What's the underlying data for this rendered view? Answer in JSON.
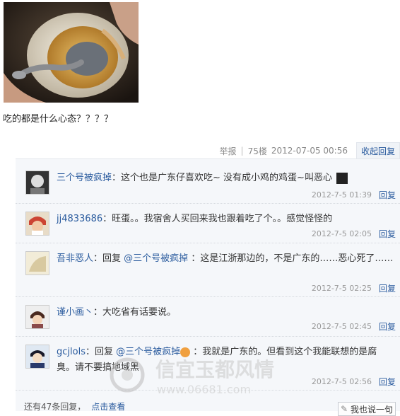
{
  "post": {
    "text": "吃的都是什么心态？？？？"
  },
  "meta": {
    "report": "举报",
    "floor": "75楼",
    "datetime": "2012-07-05 00:56",
    "collapse": "收起回复"
  },
  "replies": [
    {
      "user": "三个号被疯掉",
      "sep": "：",
      "content": "这个也是广东仔喜欢吃~ 没有成小鸡的鸡蛋~叫恶心",
      "time": "2012-7-5 01:39",
      "reply_label": "回复"
    },
    {
      "user": "jj4833686",
      "sep": "：",
      "content": "旺蛋。。我宿舍人买回来我也跟着吃了个。。感觉怪怪的",
      "time": "2012-7-5 02:05",
      "reply_label": "回复"
    },
    {
      "user": "吾非恶人",
      "sep": "：",
      "prefix": "回复 ",
      "mention": "@三个号被疯掉",
      "content": " ：这是江浙那边的，不是广东的……恶心死了……",
      "time": "2012-7-5 02:25",
      "reply_label": "回复"
    },
    {
      "user": "谨小画丶",
      "sep": "：",
      "content": "大吃省有话要说。",
      "time": "2012-7-5 02:45",
      "reply_label": "回复"
    },
    {
      "user": "gcjlols",
      "sep": "：",
      "prefix": "回复 ",
      "mention": "@三个号被疯掉",
      "content": " ：我就是广东的。但看到这个我能联想的是腐臭。请不要搞地域黑",
      "time": "2012-7-5 02:56",
      "reply_label": "回复"
    }
  ],
  "footer": {
    "more_text": "还有47条回复，",
    "view_link": "点击查看",
    "say_button": "我也说一句"
  },
  "watermark": {
    "title": "信宜玉都风情",
    "url": "www.06681.com"
  }
}
